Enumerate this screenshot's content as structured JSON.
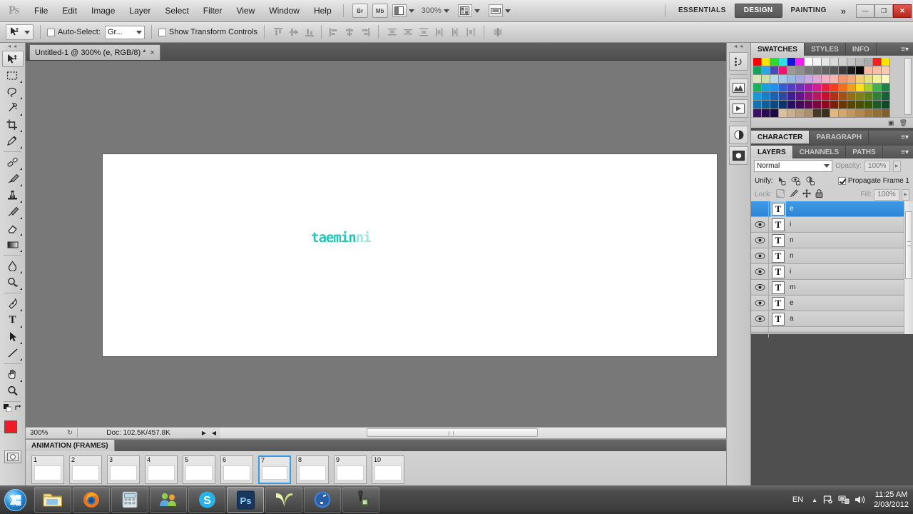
{
  "app": {
    "logo": "Ps"
  },
  "menu": {
    "items": [
      {
        "label": "File"
      },
      {
        "label": "Edit"
      },
      {
        "label": "Image"
      },
      {
        "label": "Layer"
      },
      {
        "label": "Select"
      },
      {
        "label": "Filter"
      },
      {
        "label": "View"
      },
      {
        "label": "Window"
      },
      {
        "label": "Help"
      }
    ],
    "bridge_label": "Br",
    "minibridge_label": "Mb",
    "view_extras_icon": "screen-mode-icon",
    "zoom_level": "300%",
    "arrange_icon": "arrange-documents-icon",
    "screen_mode_icon": "screen-mode-icon"
  },
  "workspace": {
    "tabs": [
      {
        "label": "ESSENTIALS",
        "active": false
      },
      {
        "label": "DESIGN",
        "active": true
      },
      {
        "label": "PAINTING",
        "active": false
      }
    ],
    "more": "»",
    "window_controls": {
      "minimize": "—",
      "restore": "❐",
      "close": "✕"
    }
  },
  "options_bar": {
    "tool_icon": "move-tool-icon",
    "auto_select_label": "Auto-Select:",
    "auto_select_checked": false,
    "auto_select_value": "Gr...",
    "show_transform_label": "Show Transform Controls",
    "show_transform_checked": false,
    "align_icons": [
      "align-top-edges-icon",
      "align-vertical-centers-icon",
      "align-bottom-edges-icon",
      "align-left-edges-icon",
      "align-horizontal-centers-icon",
      "align-right-edges-icon",
      "distribute-top-edges-icon",
      "distribute-vertical-centers-icon",
      "distribute-bottom-edges-icon",
      "distribute-left-edges-icon",
      "distribute-horizontal-centers-icon",
      "distribute-right-edges-icon",
      "auto-align-layers-icon"
    ]
  },
  "toolbar": {
    "tools": [
      {
        "name": "move-tool",
        "selected": true
      },
      {
        "name": "rectangular-marquee-tool",
        "selected": false
      },
      {
        "name": "lasso-tool",
        "selected": false
      },
      {
        "name": "magic-wand-tool",
        "selected": false
      },
      {
        "name": "crop-tool",
        "selected": false
      },
      {
        "name": "eyedropper-tool",
        "selected": false
      },
      {
        "name": "spot-healing-brush-tool",
        "selected": false
      },
      {
        "name": "brush-tool",
        "selected": false
      },
      {
        "name": "clone-stamp-tool",
        "selected": false
      },
      {
        "name": "history-brush-tool",
        "selected": false
      },
      {
        "name": "eraser-tool",
        "selected": false
      },
      {
        "name": "gradient-tool",
        "selected": false
      },
      {
        "name": "blur-tool",
        "selected": false
      },
      {
        "name": "dodge-tool",
        "selected": false
      },
      {
        "name": "pen-tool",
        "selected": false
      },
      {
        "name": "horizontal-type-tool",
        "selected": false
      },
      {
        "name": "path-selection-tool",
        "selected": false
      },
      {
        "name": "line-tool",
        "selected": false
      },
      {
        "name": "hand-tool",
        "selected": false
      },
      {
        "name": "zoom-tool",
        "selected": false
      }
    ],
    "type_tool_glyph": "T",
    "foreground_color": "#ee1c25",
    "background_color": "#ffffff"
  },
  "document": {
    "tab_title": "Untitled-1 @ 300% (e, RGB/8) *",
    "tab_close": "×",
    "canvas_text": "taemin",
    "canvas_text_faded": "ni",
    "canvas_text_color": "#27c3b4"
  },
  "status_bar": {
    "zoom": "300%",
    "doc_info": "Doc: 102.5K/457.8K",
    "left_arrow": "◀",
    "right_arrow": "▶"
  },
  "animation": {
    "tab_label": "ANIMATION (FRAMES)",
    "menu_icon": "panel-menu-icon",
    "frames": [
      {
        "number": "1",
        "selected": false
      },
      {
        "number": "2",
        "selected": false
      },
      {
        "number": "3",
        "selected": false
      },
      {
        "number": "4",
        "selected": false
      },
      {
        "number": "5",
        "selected": false
      },
      {
        "number": "6",
        "selected": false
      },
      {
        "number": "7",
        "selected": true
      },
      {
        "number": "8",
        "selected": false
      },
      {
        "number": "9",
        "selected": false
      },
      {
        "number": "10",
        "selected": false
      }
    ]
  },
  "icon_dock": {
    "buttons": [
      {
        "name": "history-panel-icon"
      },
      {
        "name": "histogram-panel-icon"
      },
      {
        "name": "animation-panel-icon"
      },
      {
        "name": "adjustments-panel-icon"
      },
      {
        "name": "masks-panel-icon"
      }
    ]
  },
  "swatches_panel": {
    "tabs": [
      {
        "label": "SWATCHES",
        "active": true
      },
      {
        "label": "STYLES",
        "active": false
      },
      {
        "label": "INFO",
        "active": false
      }
    ],
    "menu_icon": "panel-menu-icon",
    "rows": [
      [
        "#ff0000",
        "#ffe400",
        "#32d832",
        "#2ee0e0",
        "#1414d8",
        "#ee22ee",
        "#ffffff",
        "#f2f2f2",
        "#e6e6e6",
        "#dadada",
        "#cfcfcf",
        "#c3c3c3",
        "#b7b7b7",
        "#ababab",
        "#ee2222",
        "#ffe400"
      ],
      [
        "#18a35a",
        "#2aa8e0",
        "#4a4ab4",
        "#ee1470",
        "#9a9a9a",
        "#8e8e8e",
        "#7a7a7a",
        "#6e6e6e",
        "#626262",
        "#565656",
        "#3a3a3a",
        "#1c1c1c",
        "#080808",
        "#f5b8a0",
        "#f7c0a8",
        "#f9cbb0"
      ],
      [
        "#d8e8b8",
        "#c8e0a8",
        "#b8d8e8",
        "#a8c8e8",
        "#98b8e0",
        "#a8a8e0",
        "#c8a8e0",
        "#e0a8d0",
        "#f0b0c0",
        "#f0b8b0",
        "#f09870",
        "#f0a880",
        "#eed070",
        "#e8e080",
        "#f0f0a0",
        "#f8f8c0"
      ],
      [
        "#18b058",
        "#1aa0d8",
        "#2090e8",
        "#3060d0",
        "#5040c0",
        "#7030b8",
        "#a020a8",
        "#d02090",
        "#e82040",
        "#f04020",
        "#f07020",
        "#f0a020",
        "#f8e020",
        "#a8d030",
        "#40b050",
        "#208048"
      ],
      [
        "#1898d8",
        "#1880c8",
        "#2060b0",
        "#3048a0",
        "#402090",
        "#601888",
        "#901878",
        "#b81860",
        "#c81030",
        "#b03018",
        "#a05018",
        "#907018",
        "#808018",
        "#608020",
        "#308038",
        "#186038"
      ],
      [
        "#1470b0",
        "#125c98",
        "#104880",
        "#0c3468",
        "#281060",
        "#400c58",
        "#600850",
        "#780840",
        "#900820",
        "#782008",
        "#683808",
        "#584808",
        "#485008",
        "#385808",
        "#205828",
        "#104828"
      ],
      [
        "#3a1060",
        "#2a0c50",
        "#1a0840",
        "#d8c0a0",
        "#c8b090",
        "#b8a080",
        "#a89070",
        "#483828",
        "#383020",
        "#e0b880",
        "#d0a870",
        "#c09860",
        "#b08850",
        "#a07840",
        "#907038",
        "#806030"
      ]
    ],
    "footer_icons": [
      "new-swatch-icon",
      "delete-swatch-icon"
    ]
  },
  "character_panel": {
    "tabs": [
      {
        "label": "CHARACTER",
        "active": true
      },
      {
        "label": "PARAGRAPH",
        "active": false
      }
    ],
    "menu_icon": "panel-menu-icon"
  },
  "layers_panel": {
    "tabs": [
      {
        "label": "LAYERS",
        "active": true
      },
      {
        "label": "CHANNELS",
        "active": false
      },
      {
        "label": "PATHS",
        "active": false
      }
    ],
    "menu_icon": "panel-menu-icon",
    "blend_mode": "Normal",
    "opacity_label": "Opacity:",
    "opacity_value": "100%",
    "unify_label": "Unify:",
    "unify_icons": [
      "unify-layer-position-icon",
      "unify-layer-visibility-icon",
      "unify-layer-style-icon"
    ],
    "propagate_label": "Propagate Frame 1",
    "propagate_checked": true,
    "lock_label": "Lock:",
    "lock_icons": [
      "lock-transparent-pixels-icon",
      "lock-image-pixels-icon",
      "lock-position-icon",
      "lock-all-icon"
    ],
    "fill_label": "Fill:",
    "fill_value": "100%",
    "layers": [
      {
        "name": "e",
        "visible": false,
        "selected": true
      },
      {
        "name": "i",
        "visible": true,
        "selected": false
      },
      {
        "name": "n",
        "visible": true,
        "selected": false
      },
      {
        "name": "n",
        "visible": true,
        "selected": false
      },
      {
        "name": "i",
        "visible": true,
        "selected": false
      },
      {
        "name": "m",
        "visible": true,
        "selected": false
      },
      {
        "name": "e",
        "visible": true,
        "selected": false
      },
      {
        "name": "a",
        "visible": true,
        "selected": false
      }
    ],
    "layer_type_glyph": "T",
    "eye_glyph": "◉"
  },
  "taskbar": {
    "start_label": "start-orb",
    "apps": [
      {
        "name": "windows-explorer",
        "state": "running"
      },
      {
        "name": "mozilla-firefox",
        "state": "running"
      },
      {
        "name": "calculator",
        "state": "running"
      },
      {
        "name": "windows-live-messenger",
        "state": "running"
      },
      {
        "name": "skype",
        "state": "running"
      },
      {
        "name": "adobe-photoshop",
        "state": "active"
      },
      {
        "name": "notepad-document",
        "state": "running"
      },
      {
        "name": "itunes",
        "state": "running"
      },
      {
        "name": "webcam-app",
        "state": "running"
      }
    ],
    "tray": {
      "language": "EN",
      "show_hidden_icons": "▲",
      "action_center": "flag-icon",
      "network": "network-icon",
      "volume": "volume-icon",
      "time": "11:25 AM",
      "date": "2/03/2012"
    }
  }
}
